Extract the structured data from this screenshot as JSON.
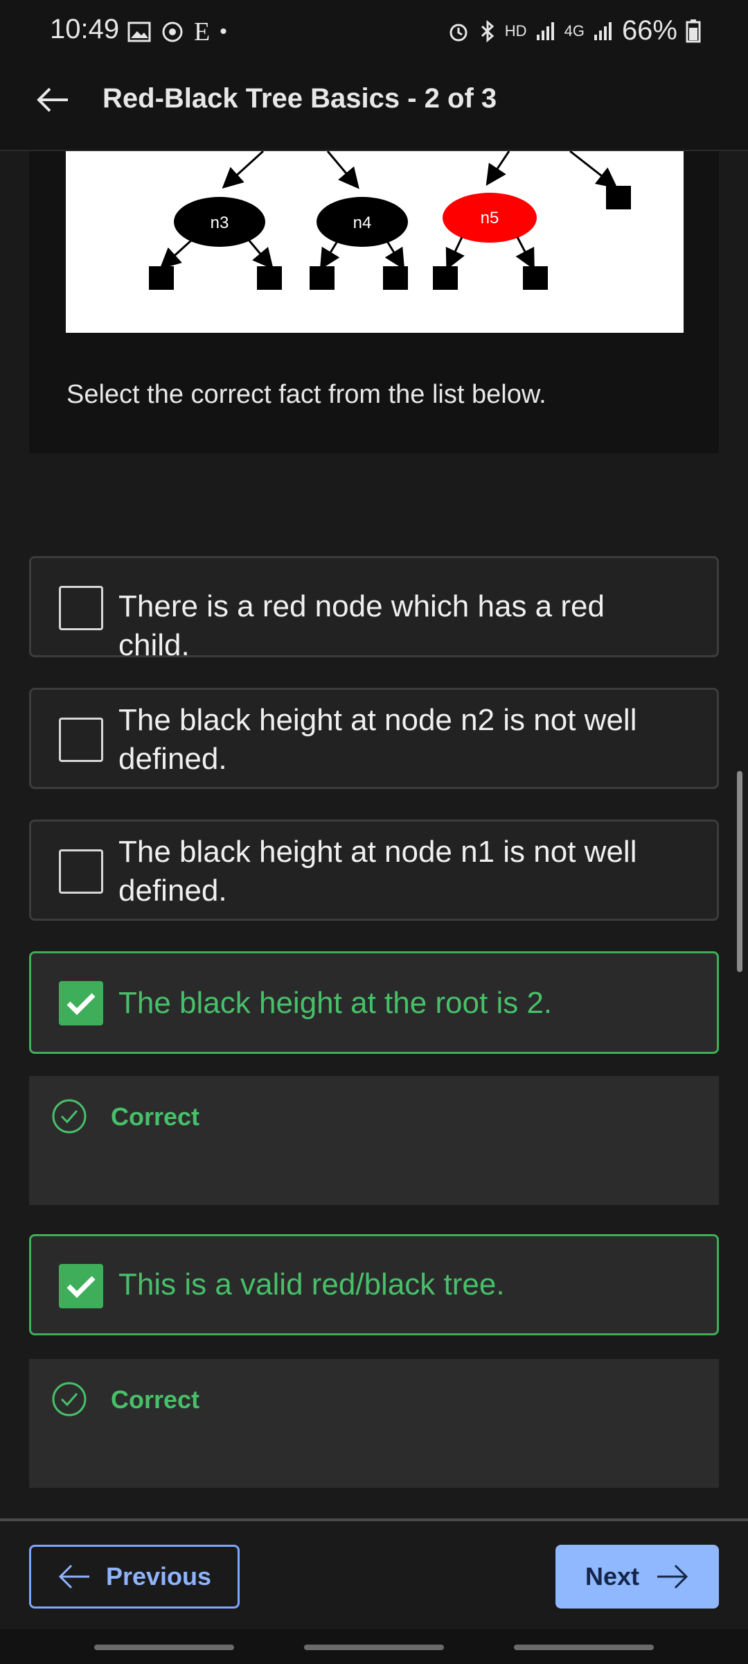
{
  "status_bar": {
    "time": "10:49",
    "e_glyph": "E",
    "dot": "•",
    "hd": "HD",
    "net": "4G",
    "battery": "66%"
  },
  "app_bar": {
    "title": "Red-Black Tree Basics - 2 of 3"
  },
  "question": {
    "tree_nodes": [
      {
        "label": "n3",
        "color": "black"
      },
      {
        "label": "n4",
        "color": "black"
      },
      {
        "label": "n5",
        "color": "red"
      }
    ],
    "prompt": "Select the correct fact from the list below."
  },
  "options": [
    {
      "text": "There is a red node which has a red child.",
      "checked": false
    },
    {
      "text": "The black height at node n2 is not well defined.",
      "checked": false
    },
    {
      "text": "The black height at node n1 is not well defined.",
      "checked": false
    },
    {
      "text": "The black height at the root is 2.",
      "checked": true,
      "feedback": "Correct"
    },
    {
      "text": "This is a valid red/black tree.",
      "checked": true,
      "feedback": "Correct"
    }
  ],
  "nav": {
    "previous_label": "Previous",
    "next_label": "Next"
  },
  "colors": {
    "correct_green": "#47c06a",
    "accent_blue": "#8fb8ff",
    "red_node": "#ff0000"
  }
}
